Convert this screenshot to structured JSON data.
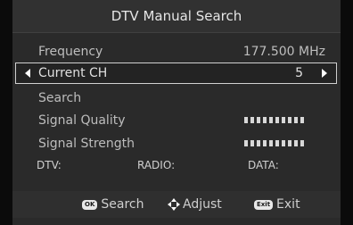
{
  "dialog": {
    "title": "DTV Manual Search"
  },
  "settings": {
    "frequency": {
      "label": "Frequency",
      "value": "177.500 MHz"
    },
    "current_ch": {
      "label": "Current CH",
      "value": "5"
    },
    "search": {
      "label": "Search"
    },
    "signal_quality": {
      "label": "Signal Quality",
      "bars": 10
    },
    "signal_strength": {
      "label": "Signal Strength",
      "bars": 10
    }
  },
  "counts": {
    "dtv": "DTV:",
    "radio": "RADIO:",
    "data": "DATA:"
  },
  "footer": {
    "ok_key": "OK",
    "ok_label": "Search",
    "adjust_label": "Adjust",
    "exit_key": "Exit",
    "exit_label": "Exit"
  },
  "colors": {
    "panel": "#2a2a2a",
    "highlight_border": "#d0d0d0"
  },
  "icons": [
    "left-arrow-icon",
    "right-arrow-icon",
    "dpad-icon",
    "ok-key-icon",
    "exit-key-icon"
  ]
}
